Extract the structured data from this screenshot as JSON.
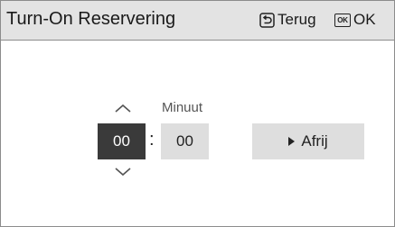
{
  "header": {
    "title": "Turn-On Reservering",
    "back_label": "Terug",
    "ok_label": "OK",
    "ok_icon_text": "OK"
  },
  "time": {
    "minute_label": "Minuut",
    "hours": "00",
    "separator": ":",
    "minutes": "00"
  },
  "actions": {
    "cancel_label": "Afrij"
  }
}
